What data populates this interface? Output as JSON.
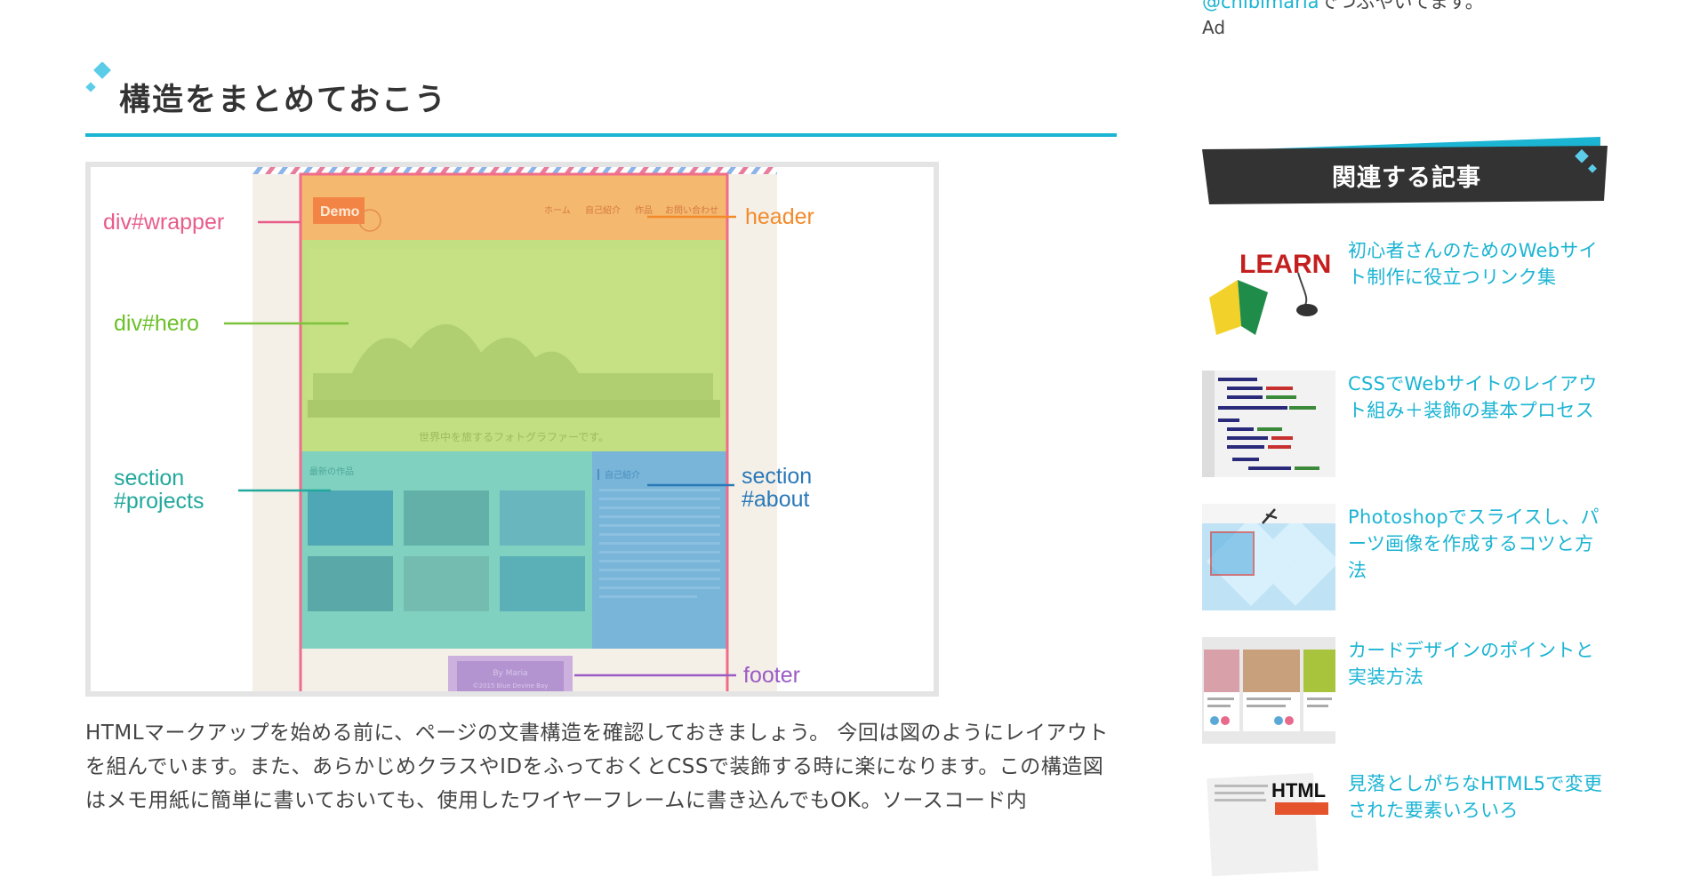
{
  "section": {
    "heading": "構造をまとめておこう"
  },
  "figure": {
    "labels": {
      "wrapper": "div#wrapper",
      "header": "header",
      "hero": "div#hero",
      "projects_line1": "section",
      "projects_line2": "#projects",
      "about_line1": "section",
      "about_line2": "#about",
      "footer": "footer"
    },
    "mock_site": {
      "logo": "Demo",
      "nav": [
        "ホーム",
        "自己紹介",
        "作品",
        "お問い合わせ"
      ],
      "hero_caption": "世界中を旅するフォトグラファーです。",
      "projects_title": "最新の作品",
      "about_title": "自己紹介",
      "footer_line1": "By Maria",
      "footer_line2": "©2015 Blue Devine Bay"
    },
    "colors": {
      "wrapper": "#f06c8a",
      "header": "#f5a03c",
      "hero": "#8ed03c",
      "projects": "#26b2a6",
      "about": "#2f86c2",
      "footer": "#9a5bc5"
    }
  },
  "body": {
    "paragraph": "HTMLマークアップを始める前に、ページの文書構造を確認しておきましょう。 今回は図のようにレイアウトを組んでいます。また、あらかじめクラスやIDをふっておくとCSSで装飾する時に楽になります。この構造図はメモ用紙に簡単に書いておいても、使用したワイヤーフレームに書き込んでもOK。ソースコード内"
  },
  "sidebar": {
    "top_link": "@chibimaria",
    "top_link_tail": "でつぶやいてます。",
    "ad_label": "Ad",
    "related_title": "関連する記事",
    "articles": [
      {
        "title": "初心者さんのためのWebサイト制作に役立つリンク集",
        "thumb_icon": "learn-icon"
      },
      {
        "title": "CSSでWebサイトのレイアウト組み＋装飾の基本プロセス",
        "thumb_icon": "css-code-icon"
      },
      {
        "title": "Photoshopでスライスし、パーツ画像を作成するコツと方法",
        "thumb_icon": "photoshop-slice-icon"
      },
      {
        "title": "カードデザインのポイントと実装方法",
        "thumb_icon": "card-design-icon"
      },
      {
        "title": "見落としがちなHTML5で変更された要素いろいろ",
        "thumb_icon": "html5-icon"
      }
    ],
    "thumb_text": {
      "learn": "LEARN",
      "html": "HTML"
    }
  },
  "accent_color": "#1bb4d3"
}
